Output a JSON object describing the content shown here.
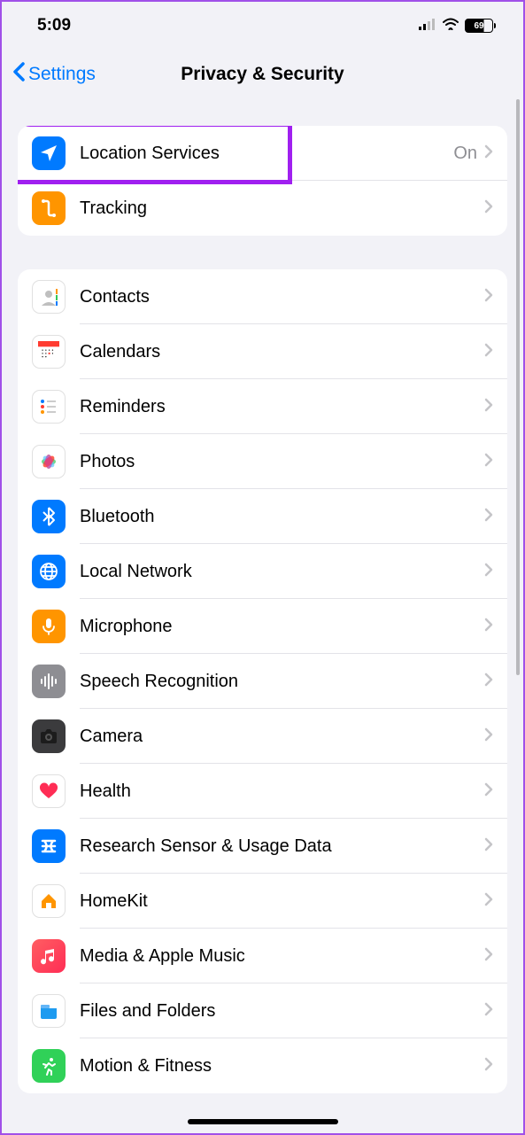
{
  "status": {
    "time": "5:09",
    "battery": "69"
  },
  "nav": {
    "back": "Settings",
    "title": "Privacy & Security"
  },
  "group1": [
    {
      "label": "Location Services",
      "value": "On",
      "icon": "location-arrow-icon",
      "highlighted": true
    },
    {
      "label": "Tracking",
      "value": "",
      "icon": "tracking-icon"
    }
  ],
  "group2": [
    {
      "label": "Contacts",
      "icon": "contacts-icon"
    },
    {
      "label": "Calendars",
      "icon": "calendar-icon"
    },
    {
      "label": "Reminders",
      "icon": "reminders-icon"
    },
    {
      "label": "Photos",
      "icon": "photos-icon"
    },
    {
      "label": "Bluetooth",
      "icon": "bluetooth-icon"
    },
    {
      "label": "Local Network",
      "icon": "local-network-icon"
    },
    {
      "label": "Microphone",
      "icon": "microphone-icon"
    },
    {
      "label": "Speech Recognition",
      "icon": "speech-recognition-icon"
    },
    {
      "label": "Camera",
      "icon": "camera-icon"
    },
    {
      "label": "Health",
      "icon": "health-icon"
    },
    {
      "label": "Research Sensor & Usage Data",
      "icon": "research-icon"
    },
    {
      "label": "HomeKit",
      "icon": "homekit-icon"
    },
    {
      "label": "Media & Apple Music",
      "icon": "music-icon"
    },
    {
      "label": "Files and Folders",
      "icon": "files-icon"
    },
    {
      "label": "Motion & Fitness",
      "icon": "fitness-icon"
    }
  ]
}
